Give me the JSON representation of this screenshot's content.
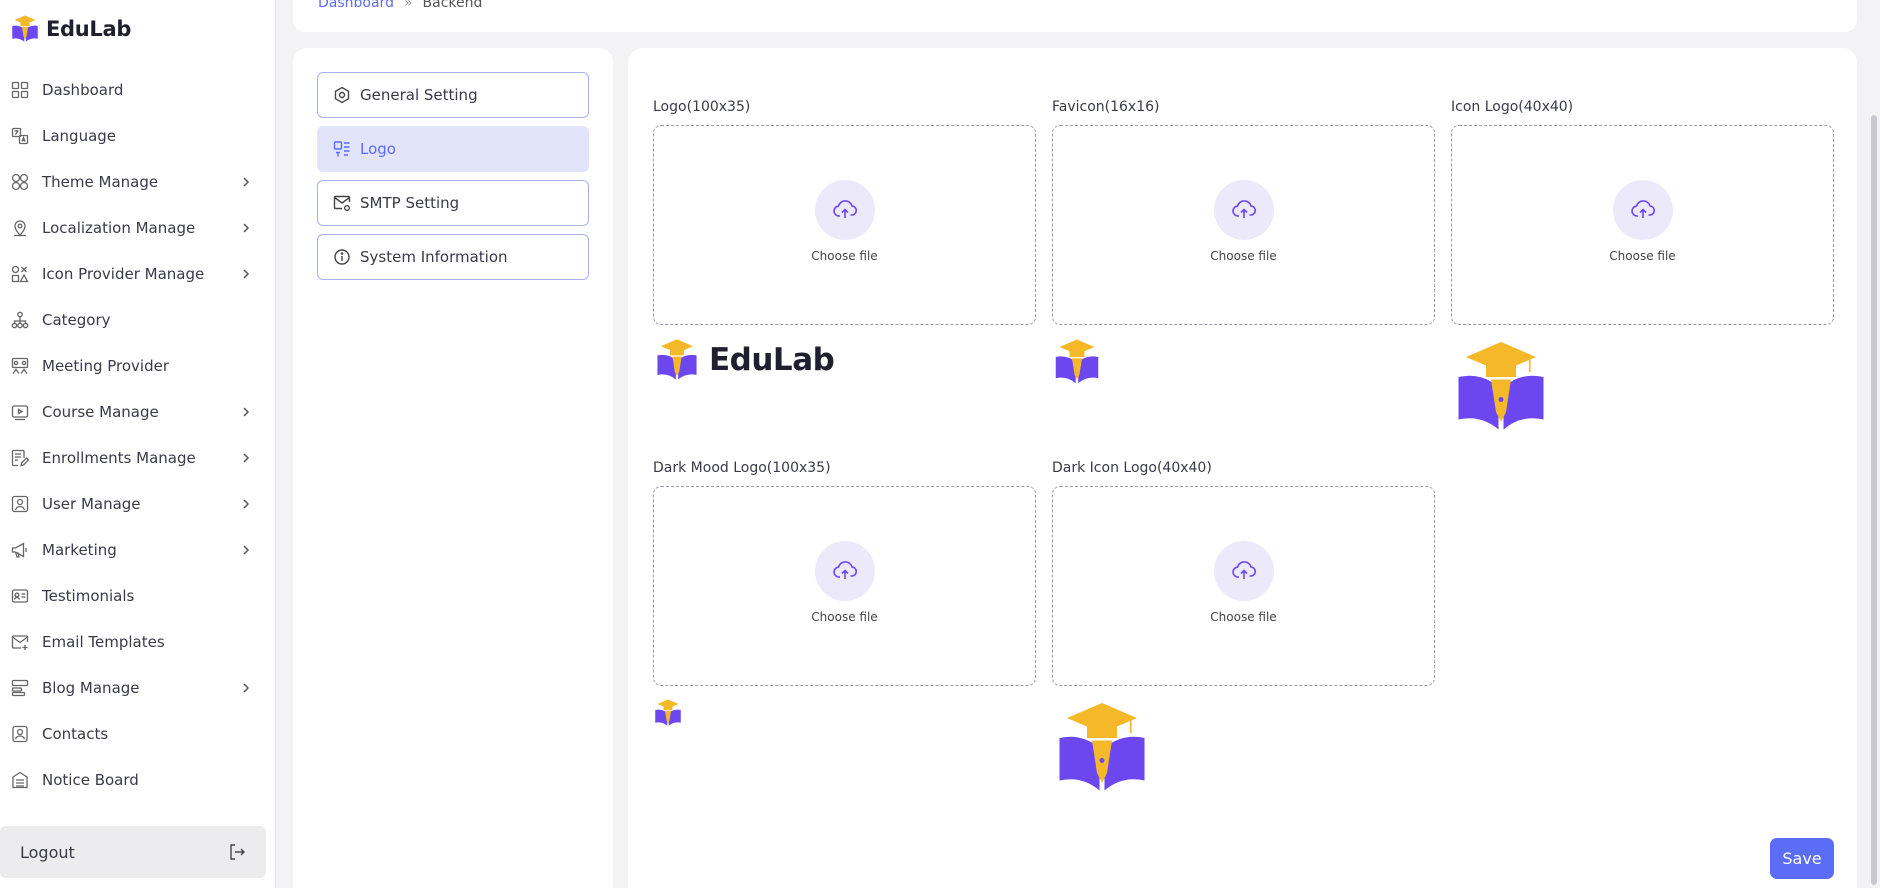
{
  "brand": {
    "name": "EduLab"
  },
  "breadcrumb": {
    "parent": "Dashboard",
    "separator": "»",
    "current": "Backend"
  },
  "sidebar": {
    "items": [
      {
        "label": "Dashboard",
        "icon": "dashboard-icon",
        "has_submenu": false
      },
      {
        "label": "Language",
        "icon": "language-icon",
        "has_submenu": false
      },
      {
        "label": "Theme Manage",
        "icon": "theme-icon",
        "has_submenu": true
      },
      {
        "label": "Localization Manage",
        "icon": "location-pin-icon",
        "has_submenu": true
      },
      {
        "label": "Icon Provider Manage",
        "icon": "shapes-icon",
        "has_submenu": true
      },
      {
        "label": "Category",
        "icon": "hierarchy-icon",
        "has_submenu": false
      },
      {
        "label": "Meeting Provider",
        "icon": "meeting-icon",
        "has_submenu": false
      },
      {
        "label": "Course Manage",
        "icon": "video-icon",
        "has_submenu": true
      },
      {
        "label": "Enrollments Manage",
        "icon": "edit-doc-icon",
        "has_submenu": true
      },
      {
        "label": "User Manage",
        "icon": "user-icon",
        "has_submenu": true
      },
      {
        "label": "Marketing",
        "icon": "megaphone-icon",
        "has_submenu": true
      },
      {
        "label": "Testimonials",
        "icon": "id-card-icon",
        "has_submenu": false
      },
      {
        "label": "Email Templates",
        "icon": "mail-icon",
        "has_submenu": false
      },
      {
        "label": "Blog Manage",
        "icon": "blog-icon",
        "has_submenu": true
      },
      {
        "label": "Contacts",
        "icon": "contacts-icon",
        "has_submenu": false
      },
      {
        "label": "Notice Board",
        "icon": "notice-icon",
        "has_submenu": false
      }
    ],
    "logout_label": "Logout"
  },
  "settings_menu": {
    "items": [
      {
        "label": "General Setting",
        "icon": "settings-hex-icon",
        "active": false
      },
      {
        "label": "Logo",
        "icon": "logo-icon",
        "active": true
      },
      {
        "label": "SMTP Setting",
        "icon": "mail-settings-icon",
        "active": false
      },
      {
        "label": "System Information",
        "icon": "info-icon",
        "active": false
      }
    ]
  },
  "logo_fields": {
    "logo": {
      "label": "Logo(100x35)",
      "choose_label": "Choose file"
    },
    "favicon": {
      "label": "Favicon(16x16)",
      "choose_label": "Choose file"
    },
    "icon_logo": {
      "label": "Icon Logo(40x40)",
      "choose_label": "Choose file"
    },
    "dark_logo": {
      "label": "Dark Mood Logo(100x35)",
      "choose_label": "Choose file"
    },
    "dark_icon_logo": {
      "label": "Dark Icon Logo(40x40)",
      "choose_label": "Choose file"
    }
  },
  "preview_wordmark": "EduLab",
  "save_label": "Save",
  "colors": {
    "accent": "#5b6cf6",
    "logo_purple": "#6c47f0",
    "logo_gold": "#f4b829"
  }
}
